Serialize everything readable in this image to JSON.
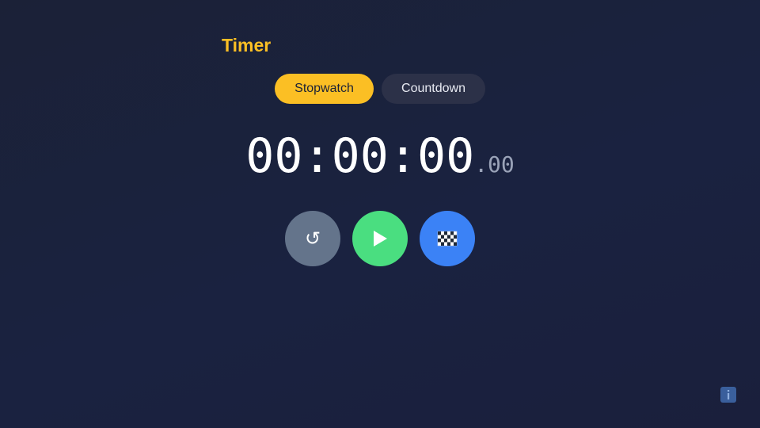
{
  "app": {
    "title": "Timer"
  },
  "modes": [
    {
      "label": "Stopwatch",
      "active": true
    },
    {
      "label": "Countdown",
      "active": false
    }
  ],
  "display": {
    "main": "00:00:00",
    "fraction": ".00"
  },
  "controls": {
    "reset_icon": "reset-icon",
    "play_icon": "play-icon",
    "lap_icon": "checkered-flag-icon"
  },
  "colors": {
    "accent": "#fbbf24",
    "play": "#4ade80",
    "lap": "#3b82f6",
    "reset": "#64748b",
    "background": "#1a2240"
  },
  "info": {
    "icon": "info-icon"
  }
}
